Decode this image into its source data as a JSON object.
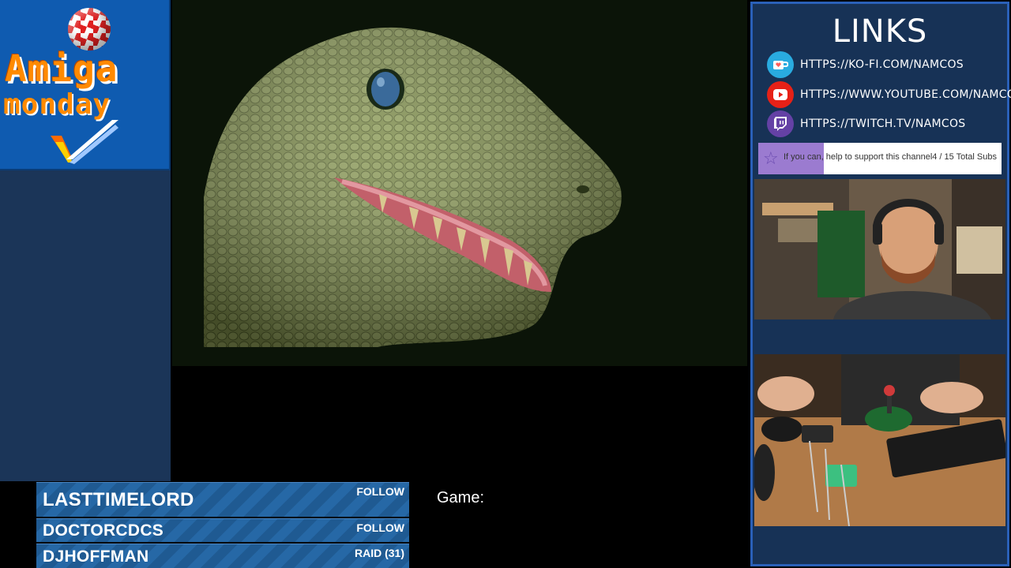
{
  "logo": {
    "line1": "Amiga",
    "line2": "monday",
    "ball_colors": [
      "#e02020",
      "#ffffff"
    ],
    "text_color": "#ff8a00",
    "icon": "amiga-checkmark-icon"
  },
  "links": {
    "title": "LINKS",
    "items": [
      {
        "icon": "kofi-icon",
        "url": "HTTPS://KO-FI.COM/NAMCOS",
        "color": "#29abe0"
      },
      {
        "icon": "youtube-icon",
        "url": "HTTPS://WWW.YOUTUBE.COM/NAMCOS",
        "color": "#e62117"
      },
      {
        "icon": "twitch-icon",
        "url": "HTTPS://TWITCH.TV/NAMCOS",
        "color": "#6441a5"
      }
    ]
  },
  "support": {
    "message": "If you can, help to support this channel",
    "count": "4 / 15 Total Subs",
    "progress": 0.27,
    "fill_color": "#9b7bd0"
  },
  "alerts": [
    {
      "name": "LASTTIMELORD",
      "tag": "FOLLOW"
    },
    {
      "name": "DOCTORCDCS",
      "tag": "FOLLOW"
    },
    {
      "name": "DJHOFFMAN",
      "tag": "RAID (31)"
    }
  ],
  "game_label": "Game:",
  "colors": {
    "panel_bg": "#173256",
    "panel_border": "#2a60b8",
    "alert_bg": "#1f5a92"
  }
}
